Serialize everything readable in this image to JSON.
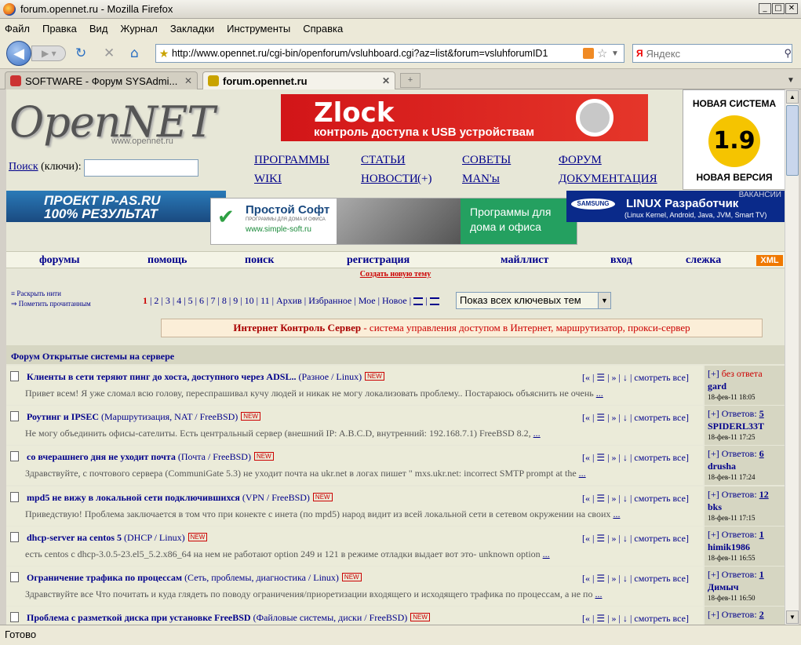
{
  "window": {
    "title": "forum.opennet.ru - Mozilla Firefox"
  },
  "menu": [
    "Файл",
    "Правка",
    "Вид",
    "Журнал",
    "Закладки",
    "Инструменты",
    "Справка"
  ],
  "nav": {
    "url": "http://www.opennet.ru/cgi-bin/openforum/vsluhboard.cgi?az=list&forum=vsluhforumID1",
    "search_placeholder": "Яндекс",
    "search_engine": "Я"
  },
  "tabs": [
    {
      "label": "SOFTWARE - Форум SYSAdmi..."
    },
    {
      "label": "forum.opennet.ru"
    }
  ],
  "status": "Готово",
  "site": {
    "logo": "OpenNET",
    "logo_sub": "www.opennet.ru",
    "banner_zlock": {
      "title": "Zlock",
      "subtitle": "контроль доступа к USB устройствам"
    },
    "banner_version": {
      "top": "НОВАЯ СИСТЕМА",
      "ver": "1.9",
      "bottom": "НОВАЯ ВЕРСИЯ"
    },
    "search_label": "Поиск",
    "search_suffix": "(ключи):",
    "links": [
      "ПРОГРАММЫ",
      "СТАТЬИ",
      "СОВЕТЫ",
      "ФОРУМ",
      "WIKI",
      "НОВОСТИ",
      "(+)",
      "MAN'ы",
      "ДОКУМЕНТАЦИЯ"
    ],
    "banner_ipas": {
      "line1": "ПРОЕКТ IP-AS.RU",
      "line2": "100% РЕЗУЛЬТАТ"
    },
    "banner_simple": {
      "title": "Простой Софт",
      "sub": "ПРОГРАММЫ ДЛЯ ДОМА И ОФИСА",
      "url": "www.simple-soft.ru",
      "right": "Программы для дома и офиса"
    },
    "banner_samsung": {
      "vac": "ВАКАНСИИ",
      "brand": "SAMSUNG",
      "title": "LINUX Разработчик",
      "sub": "(Linux Kernel, Android, Java, JVM, Smart TV)"
    },
    "mainnav": [
      "форумы",
      "помощь",
      "поиск",
      "регистрация",
      "майллист",
      "вход",
      "слежка"
    ],
    "xml": "XML",
    "new_topic": "Создать новую тему",
    "side_links": [
      "Раскрыть нити",
      "Пометить прочитанным"
    ],
    "pages": [
      "1",
      "2",
      "3",
      "4",
      "5",
      "6",
      "7",
      "8",
      "9",
      "10",
      "11"
    ],
    "page_links": [
      "Архив",
      "Избранное",
      "Мое",
      "Новое"
    ],
    "kw_select": "Показ всех ключевых тем",
    "ad": {
      "bold": "Интернет Контроль Сервер",
      "rest": " - система управления доступом в Интернет, маршрутизатор, прокси-сервер"
    },
    "forum_head": "Форум Открытые системы на сервере",
    "topic_controls": "[« | ☰ | » | ↓ | смотреть все]",
    "new_label": "NEW",
    "topics": [
      {
        "title": "Клиенты в сети теряют пинг до хоста, доступного через ADSL..",
        "cat": "(Разное / Linux)",
        "snippet": "Привет всем! Я уже сломал всю голову, переспрашивал кучу людей и никак не могу локализовать проблему.. Постараюсь объяснить не очень",
        "status": "[+]",
        "status2": "без ответа",
        "count": "",
        "user": "gard",
        "date": "18-фев-11 18:05"
      },
      {
        "title": "Роутинг и IPSEC",
        "cat": "(Маршрутизация, NAT / FreeBSD)",
        "snippet": "Не могу объединить офисы-сателиты. Есть центральный сервер (внешний IP: A.B.C.D, внутренний: 192.168.7.1) FreeBSD 8.2,",
        "status": "[+]",
        "status2": "Ответов:",
        "count": "5",
        "user": "SPIDERL33T",
        "date": "18-фев-11 17:25"
      },
      {
        "title": "со вчерашнего дня не уходит почта",
        "cat": "(Почта / FreeBSD)",
        "snippet": "Здравствуйте, с почтового сервера (CommuniGate 5.3) не уходит почта на ukr.net в логах пишет \" mxs.ukr.net: incorrect SMTP prompt at the",
        "status": "[+]",
        "status2": "Ответов:",
        "count": "6",
        "user": "drusha",
        "date": "18-фев-11 17:24"
      },
      {
        "title": "mpd5 не вижу в локальной сети подключившихся",
        "cat": "(VPN / FreeBSD)",
        "snippet": "Приведствую! Проблема заключается в том что при конекте с инета (по mpd5) народ видит из всей локальной сети в сетевом окружении на своих",
        "status": "[+]",
        "status2": "Ответов:",
        "count": "12",
        "user": "bks",
        "date": "18-фев-11 17:15"
      },
      {
        "title": "dhcp-server на centos 5",
        "cat": "(DHCP / Linux)",
        "snippet": "есть centos с dhcp-3.0.5-23.el5_5.2.x86_64 на нем не работают option 249 и 121 в режиме отладки выдает вот это- unknown option",
        "status": "[+]",
        "status2": "Ответов:",
        "count": "1",
        "user": "himik1986",
        "date": "18-фев-11 16:55"
      },
      {
        "title": "Ограничение трафика по процессам",
        "cat": "(Сеть, проблемы, диагностика / Linux)",
        "snippet": "Здравствуйте все Что почитать и куда глядеть по поводу ограничения/приоретизации входящего и исходящего трафика по процессам, а не по",
        "status": "[+]",
        "status2": "Ответов:",
        "count": "1",
        "user": "Димыч",
        "date": "18-фев-11 16:50"
      },
      {
        "title": "Проблема с разметкой диска при установке FreeBSD",
        "cat": "(Файловые системы, диски / FreeBSD)",
        "snippet": "",
        "status": "[+]",
        "status2": "Ответов:",
        "count": "2",
        "user": "",
        "date": ""
      }
    ]
  }
}
